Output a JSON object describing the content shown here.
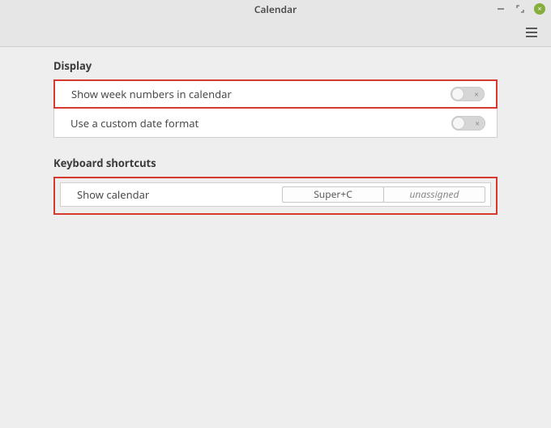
{
  "window": {
    "title": "Calendar"
  },
  "sections": {
    "display": {
      "title": "Display",
      "items": [
        {
          "label": "Show week numbers in calendar",
          "toggled": false
        },
        {
          "label": "Use a custom date format",
          "toggled": false
        }
      ]
    },
    "shortcuts": {
      "title": "Keyboard shortcuts",
      "items": [
        {
          "label": "Show calendar",
          "shortcut1": "Super+C",
          "shortcut2": "unassigned"
        }
      ]
    }
  }
}
